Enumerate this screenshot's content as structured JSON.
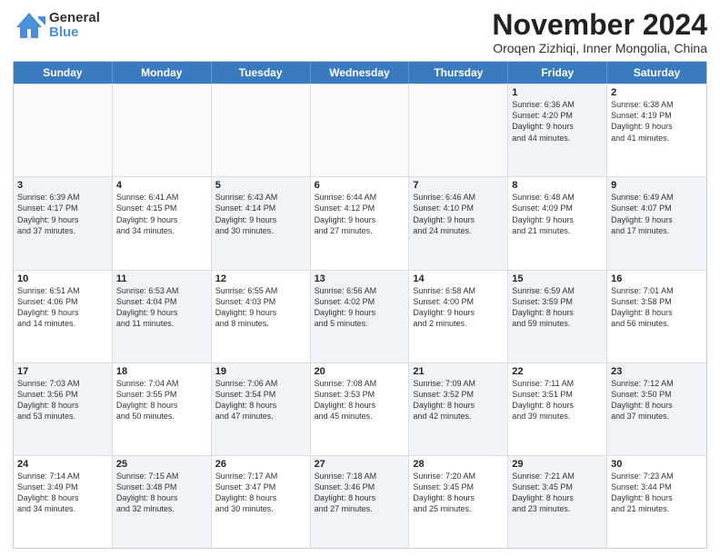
{
  "logo": {
    "general": "General",
    "blue": "Blue"
  },
  "title": {
    "month_year": "November 2024",
    "location": "Oroqen Zizhiqi, Inner Mongolia, China"
  },
  "header_days": [
    "Sunday",
    "Monday",
    "Tuesday",
    "Wednesday",
    "Thursday",
    "Friday",
    "Saturday"
  ],
  "rows": [
    [
      {
        "day": "",
        "info": "",
        "empty": true
      },
      {
        "day": "",
        "info": "",
        "empty": true
      },
      {
        "day": "",
        "info": "",
        "empty": true
      },
      {
        "day": "",
        "info": "",
        "empty": true
      },
      {
        "day": "",
        "info": "",
        "empty": true
      },
      {
        "day": "1",
        "info": "Sunrise: 6:36 AM\nSunset: 4:20 PM\nDaylight: 9 hours\nand 44 minutes.",
        "shaded": true
      },
      {
        "day": "2",
        "info": "Sunrise: 6:38 AM\nSunset: 4:19 PM\nDaylight: 9 hours\nand 41 minutes.",
        "shaded": false
      }
    ],
    [
      {
        "day": "3",
        "info": "Sunrise: 6:39 AM\nSunset: 4:17 PM\nDaylight: 9 hours\nand 37 minutes.",
        "shaded": true
      },
      {
        "day": "4",
        "info": "Sunrise: 6:41 AM\nSunset: 4:15 PM\nDaylight: 9 hours\nand 34 minutes.",
        "shaded": false
      },
      {
        "day": "5",
        "info": "Sunrise: 6:43 AM\nSunset: 4:14 PM\nDaylight: 9 hours\nand 30 minutes.",
        "shaded": true
      },
      {
        "day": "6",
        "info": "Sunrise: 6:44 AM\nSunset: 4:12 PM\nDaylight: 9 hours\nand 27 minutes.",
        "shaded": false
      },
      {
        "day": "7",
        "info": "Sunrise: 6:46 AM\nSunset: 4:10 PM\nDaylight: 9 hours\nand 24 minutes.",
        "shaded": true
      },
      {
        "day": "8",
        "info": "Sunrise: 6:48 AM\nSunset: 4:09 PM\nDaylight: 9 hours\nand 21 minutes.",
        "shaded": false
      },
      {
        "day": "9",
        "info": "Sunrise: 6:49 AM\nSunset: 4:07 PM\nDaylight: 9 hours\nand 17 minutes.",
        "shaded": true
      }
    ],
    [
      {
        "day": "10",
        "info": "Sunrise: 6:51 AM\nSunset: 4:06 PM\nDaylight: 9 hours\nand 14 minutes.",
        "shaded": false
      },
      {
        "day": "11",
        "info": "Sunrise: 6:53 AM\nSunset: 4:04 PM\nDaylight: 9 hours\nand 11 minutes.",
        "shaded": true
      },
      {
        "day": "12",
        "info": "Sunrise: 6:55 AM\nSunset: 4:03 PM\nDaylight: 9 hours\nand 8 minutes.",
        "shaded": false
      },
      {
        "day": "13",
        "info": "Sunrise: 6:56 AM\nSunset: 4:02 PM\nDaylight: 9 hours\nand 5 minutes.",
        "shaded": true
      },
      {
        "day": "14",
        "info": "Sunrise: 6:58 AM\nSunset: 4:00 PM\nDaylight: 9 hours\nand 2 minutes.",
        "shaded": false
      },
      {
        "day": "15",
        "info": "Sunrise: 6:59 AM\nSunset: 3:59 PM\nDaylight: 8 hours\nand 59 minutes.",
        "shaded": true
      },
      {
        "day": "16",
        "info": "Sunrise: 7:01 AM\nSunset: 3:58 PM\nDaylight: 8 hours\nand 56 minutes.",
        "shaded": false
      }
    ],
    [
      {
        "day": "17",
        "info": "Sunrise: 7:03 AM\nSunset: 3:56 PM\nDaylight: 8 hours\nand 53 minutes.",
        "shaded": true
      },
      {
        "day": "18",
        "info": "Sunrise: 7:04 AM\nSunset: 3:55 PM\nDaylight: 8 hours\nand 50 minutes.",
        "shaded": false
      },
      {
        "day": "19",
        "info": "Sunrise: 7:06 AM\nSunset: 3:54 PM\nDaylight: 8 hours\nand 47 minutes.",
        "shaded": true
      },
      {
        "day": "20",
        "info": "Sunrise: 7:08 AM\nSunset: 3:53 PM\nDaylight: 8 hours\nand 45 minutes.",
        "shaded": false
      },
      {
        "day": "21",
        "info": "Sunrise: 7:09 AM\nSunset: 3:52 PM\nDaylight: 8 hours\nand 42 minutes.",
        "shaded": true
      },
      {
        "day": "22",
        "info": "Sunrise: 7:11 AM\nSunset: 3:51 PM\nDaylight: 8 hours\nand 39 minutes.",
        "shaded": false
      },
      {
        "day": "23",
        "info": "Sunrise: 7:12 AM\nSunset: 3:50 PM\nDaylight: 8 hours\nand 37 minutes.",
        "shaded": true
      }
    ],
    [
      {
        "day": "24",
        "info": "Sunrise: 7:14 AM\nSunset: 3:49 PM\nDaylight: 8 hours\nand 34 minutes.",
        "shaded": false
      },
      {
        "day": "25",
        "info": "Sunrise: 7:15 AM\nSunset: 3:48 PM\nDaylight: 8 hours\nand 32 minutes.",
        "shaded": true
      },
      {
        "day": "26",
        "info": "Sunrise: 7:17 AM\nSunset: 3:47 PM\nDaylight: 8 hours\nand 30 minutes.",
        "shaded": false
      },
      {
        "day": "27",
        "info": "Sunrise: 7:18 AM\nSunset: 3:46 PM\nDaylight: 8 hours\nand 27 minutes.",
        "shaded": true
      },
      {
        "day": "28",
        "info": "Sunrise: 7:20 AM\nSunset: 3:45 PM\nDaylight: 8 hours\nand 25 minutes.",
        "shaded": false
      },
      {
        "day": "29",
        "info": "Sunrise: 7:21 AM\nSunset: 3:45 PM\nDaylight: 8 hours\nand 23 minutes.",
        "shaded": true
      },
      {
        "day": "30",
        "info": "Sunrise: 7:23 AM\nSunset: 3:44 PM\nDaylight: 8 hours\nand 21 minutes.",
        "shaded": false
      }
    ]
  ]
}
